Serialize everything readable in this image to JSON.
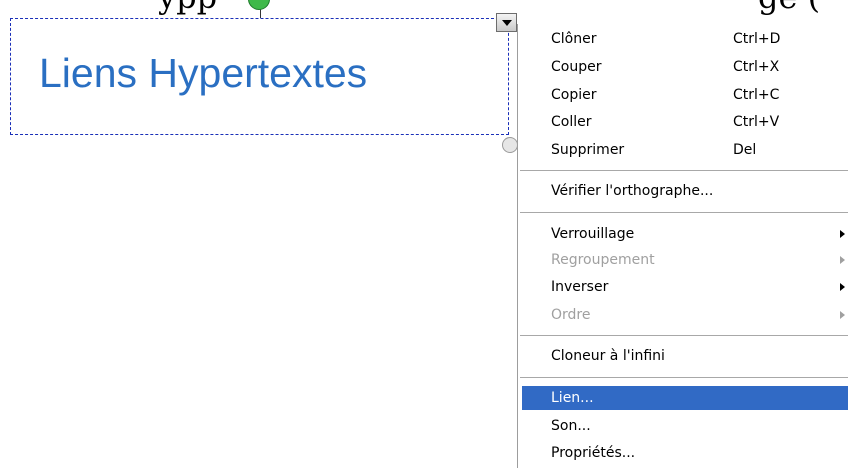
{
  "canvas": {
    "textbox_text": "Liens Hypertextes",
    "top_left_fragment": "ypp",
    "top_right_fragment": "ge ("
  },
  "context_menu": {
    "items": [
      {
        "label": "Clôner",
        "shortcut": "Ctrl+D",
        "enabled": true
      },
      {
        "label": "Couper",
        "shortcut": "Ctrl+X",
        "enabled": true
      },
      {
        "label": "Copier",
        "shortcut": "Ctrl+C",
        "enabled": true
      },
      {
        "label": "Coller",
        "shortcut": "Ctrl+V",
        "enabled": true
      },
      {
        "label": "Supprimer",
        "shortcut": "Del",
        "enabled": true
      },
      {
        "label": "Vérifier l'orthographe...",
        "enabled": true
      },
      {
        "label": "Verrouillage",
        "submenu": true,
        "enabled": true
      },
      {
        "label": "Regroupement",
        "submenu": true,
        "enabled": false
      },
      {
        "label": "Inverser",
        "submenu": true,
        "enabled": true
      },
      {
        "label": "Ordre",
        "submenu": true,
        "enabled": false
      },
      {
        "label": "Cloneur à l'infini",
        "enabled": true
      },
      {
        "label": "Lien...",
        "enabled": true,
        "highlighted": true
      },
      {
        "label": "Son...",
        "enabled": true
      },
      {
        "label": "Propriétés...",
        "enabled": true
      }
    ]
  },
  "colors": {
    "textbox_text": "#2a6fc2",
    "selection_border": "#1a2fb8",
    "highlight": "#316ac5",
    "disabled_text": "#a0a0a0",
    "rotate_handle": "#3fb94a"
  },
  "icons": {
    "menu_button": "dropdown-arrow-icon",
    "submenu": "submenu-arrow-icon"
  }
}
